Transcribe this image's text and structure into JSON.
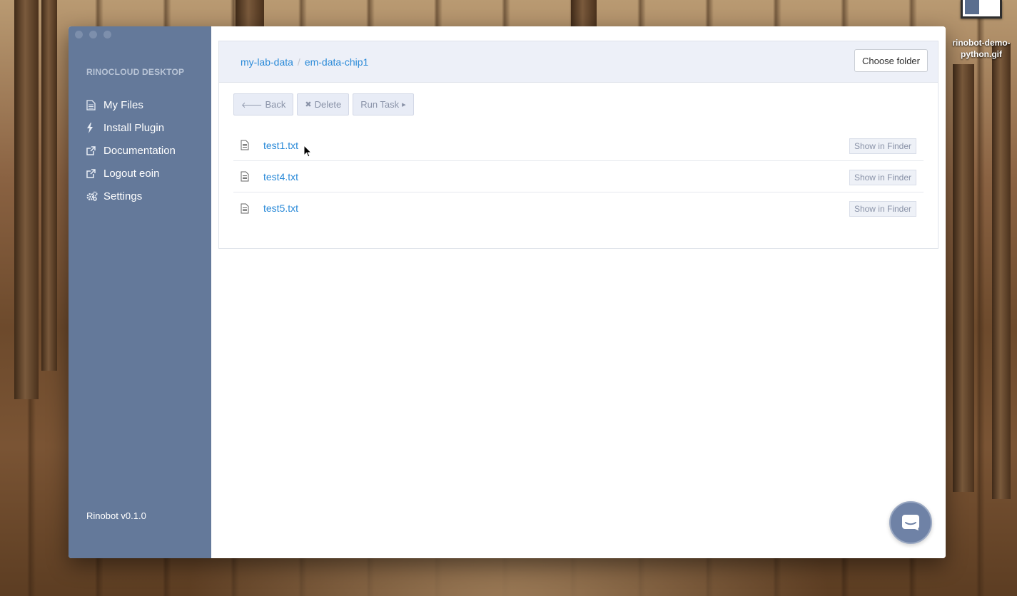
{
  "desktop": {
    "file_name_line1": "rinobot-demo-",
    "file_name_line2": "python.gif"
  },
  "sidebar": {
    "brand": "RINOCLOUD DESKTOP",
    "items": [
      {
        "label": "My Files",
        "icon": "file-icon"
      },
      {
        "label": "Install Plugin",
        "icon": "bolt-icon"
      },
      {
        "label": "Documentation",
        "icon": "external-link-icon"
      },
      {
        "label": "Logout eoin",
        "icon": "external-link-icon"
      },
      {
        "label": "Settings",
        "icon": "gears-icon"
      }
    ],
    "version": "Rinobot v0.1.0"
  },
  "main": {
    "breadcrumb": [
      "my-lab-data",
      "em-data-chip1"
    ],
    "choose_folder_label": "Choose folder",
    "toolbar": {
      "back_label": "Back",
      "delete_label": "Delete",
      "run_task_label": "Run Task"
    },
    "files": [
      {
        "name": "test1.txt",
        "action": "Show in Finder"
      },
      {
        "name": "test4.txt",
        "action": "Show in Finder"
      },
      {
        "name": "test5.txt",
        "action": "Show in Finder"
      }
    ]
  },
  "colors": {
    "sidebar_bg": "#64799a",
    "link": "#2a8ad8",
    "panel_header_bg": "#edf0f8"
  }
}
